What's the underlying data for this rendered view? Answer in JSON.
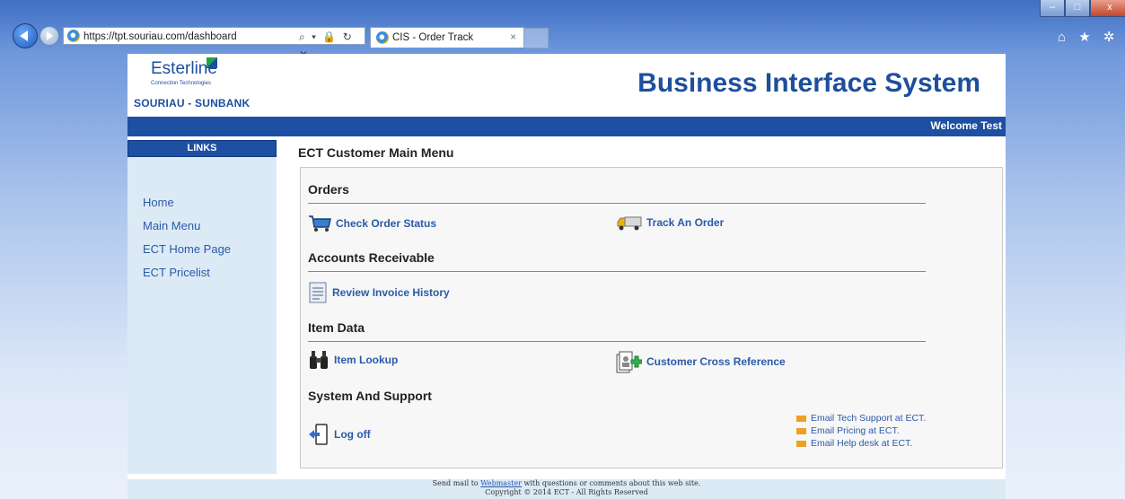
{
  "browser": {
    "url": "https://tpt.souriau.com/dashboard",
    "address_controls": "⌕ ▾ 🔒 ↻ ✕",
    "tab_title": "CIS - Order Track",
    "tab_close": "×",
    "window": {
      "minimize": "–",
      "maximize": "□",
      "close": "x"
    },
    "tools": "⌂ ★ ✲"
  },
  "header": {
    "logo_brand": "Esterline",
    "logo_tagline": "Connection Technologies",
    "logo_division": "SOURIAU - SUNBANK",
    "title": "Business Interface System",
    "welcome": "Welcome Test"
  },
  "sidebar": {
    "heading": "LINKS",
    "items": [
      {
        "label": "Home"
      },
      {
        "label": "Main Menu"
      },
      {
        "label": "ECT Home Page"
      },
      {
        "label": "ECT Pricelist"
      }
    ]
  },
  "main": {
    "title": "ECT Customer Main Menu",
    "sections": {
      "orders": "Orders",
      "ar": "Accounts Receivable",
      "item_data": "Item Data",
      "support": "System And Support"
    },
    "items": {
      "check_order": "Check Order Status",
      "track_order": "Track An Order",
      "invoice": "Review Invoice History",
      "item_lookup": "Item Lookup",
      "cross_ref": "Customer Cross Reference",
      "logoff": "Log off"
    },
    "emails": [
      "Email Tech Support at ECT.",
      "Email Pricing at ECT.",
      "Email Help desk at ECT."
    ]
  },
  "footer": {
    "prefix": "Send mail to",
    "link": "Webmaster",
    "suffix": "with questions or comments about this web site.",
    "copyright": "Copyright © 2014 ECT - All Rights Reserved"
  },
  "colors": {
    "brand_blue": "#1d4fa3",
    "link": "#2a5aa8",
    "sidebar_bg": "#dceaf6"
  }
}
